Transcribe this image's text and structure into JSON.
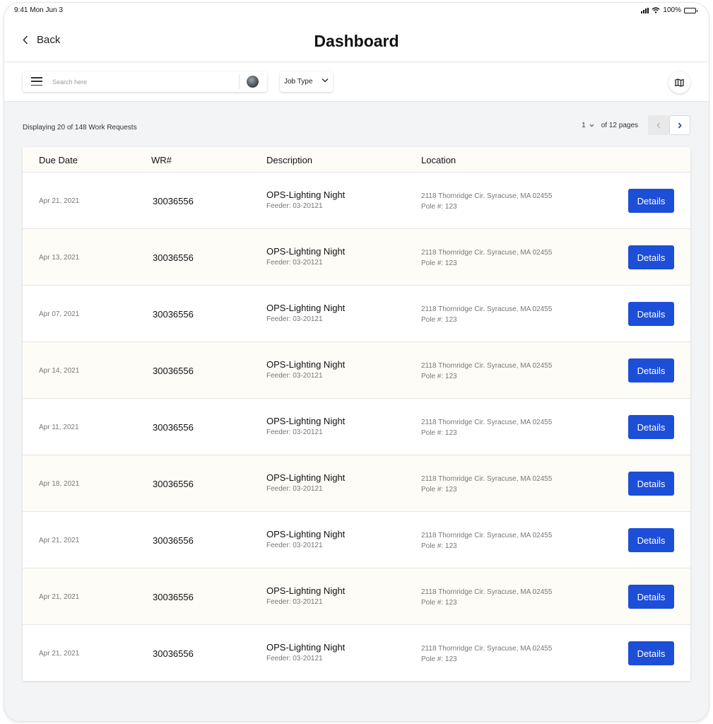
{
  "status_bar": {
    "time": "9:41  Mon Jun 3",
    "battery": "100%"
  },
  "nav": {
    "back_label": "Back",
    "title": "Dashboard"
  },
  "toolbar": {
    "search_placeholder": "Search here",
    "job_type_label": "Job Type",
    "icons": {
      "menu": "hamburger-menu-icon",
      "map": "map-icon",
      "avatar": "user-avatar"
    }
  },
  "summary": "Displaying 20 of 148 Work Requests",
  "pagination": {
    "current": "1",
    "of_text": "of 12 pages"
  },
  "table": {
    "headers": {
      "due_date": "Due Date",
      "wr": "WR#",
      "description": "Description",
      "location": "Location"
    },
    "rows": [
      {
        "date": "Apr 21, 2021",
        "wr": "30036556",
        "desc": "OPS-Lighting Night",
        "feeder": "Feeder: 03-20121",
        "address": "2118 Thornridge Cir. Syracuse, MA 02455",
        "pole": "Pole #: 123",
        "action": "Details"
      },
      {
        "date": "Apr 13, 2021",
        "wr": "30036556",
        "desc": "OPS-Lighting Night",
        "feeder": "Feeder: 03-20121",
        "address": "2118 Thornridge Cir. Syracuse, MA 02455",
        "pole": "Pole #: 123",
        "action": "Details"
      },
      {
        "date": "Apr 07, 2021",
        "wr": "30036556",
        "desc": "OPS-Lighting Night",
        "feeder": "Feeder: 03-20121",
        "address": "2118 Thornridge Cir. Syracuse, MA 02455",
        "pole": "Pole #: 123",
        "action": "Details"
      },
      {
        "date": "Apr 14, 2021",
        "wr": "30036556",
        "desc": "OPS-Lighting Night",
        "feeder": "Feeder: 03-20121",
        "address": "2118 Thornridge Cir. Syracuse, MA 02455",
        "pole": "Pole #: 123",
        "action": "Details"
      },
      {
        "date": "Apr 11, 2021",
        "wr": "30036556",
        "desc": "OPS-Lighting Night",
        "feeder": "Feeder: 03-20121",
        "address": "2118 Thornridge Cir. Syracuse, MA 02455",
        "pole": "Pole #: 123",
        "action": "Details"
      },
      {
        "date": "Apr 18, 2021",
        "wr": "30036556",
        "desc": "OPS-Lighting Night",
        "feeder": "Feeder: 03-20121",
        "address": "2118 Thornridge Cir. Syracuse, MA 02455",
        "pole": "Pole #: 123",
        "action": "Details"
      },
      {
        "date": "Apr 21, 2021",
        "wr": "30036556",
        "desc": "OPS-Lighting Night",
        "feeder": "Feeder: 03-20121",
        "address": "2118 Thornridge Cir. Syracuse, MA 02455",
        "pole": "Pole #: 123",
        "action": "Details"
      },
      {
        "date": "Apr 21, 2021",
        "wr": "30036556",
        "desc": "OPS-Lighting Night",
        "feeder": "Feeder: 03-20121",
        "address": "2118 Thornridge Cir. Syracuse, MA 02455",
        "pole": "Pole #: 123",
        "action": "Details"
      },
      {
        "date": "Apr 21, 2021",
        "wr": "30036556",
        "desc": "OPS-Lighting Night",
        "feeder": "Feeder: 03-20121",
        "address": "2118 Thornridge Cir. Syracuse, MA 02455",
        "pole": "Pole #: 123",
        "action": "Details"
      }
    ]
  },
  "colors": {
    "accent": "#1d4ed8",
    "row_alt": "#fdfcf7",
    "background": "#f3f4f6"
  }
}
